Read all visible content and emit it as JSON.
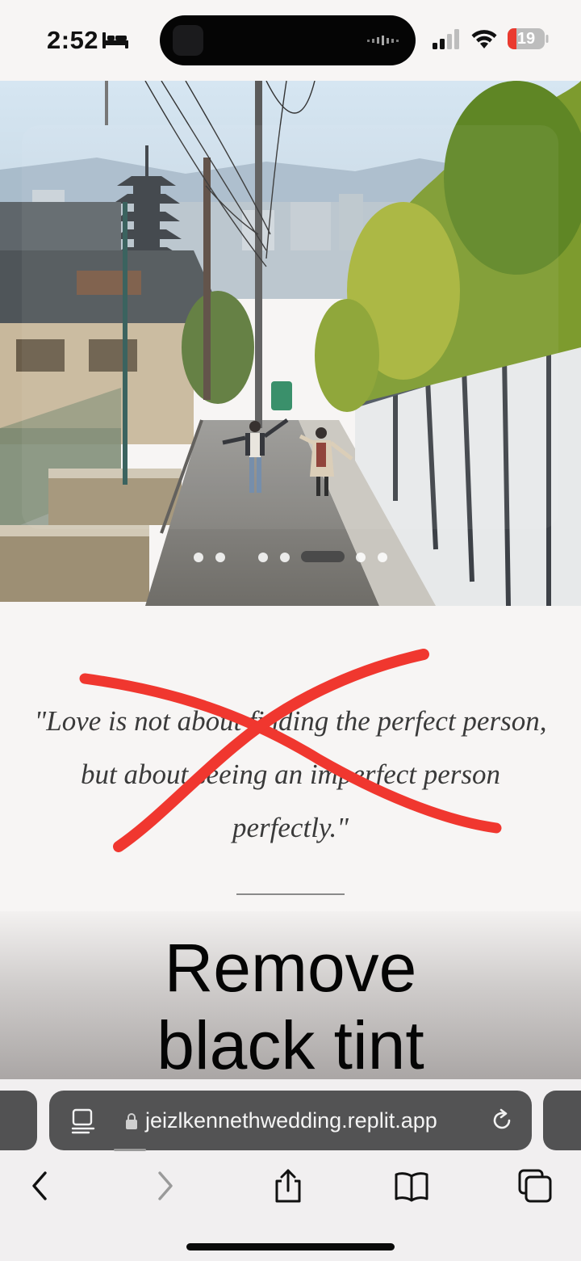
{
  "status_bar": {
    "time": "2:52",
    "battery": "19"
  },
  "carousel": {
    "slide_count": 7,
    "active_index": 5
  },
  "quote": {
    "lines": [
      "\"Love is not about finding the perfect person,",
      "but about seeing an imperfect person",
      "perfectly.\""
    ]
  },
  "overlay": {
    "lines": [
      "Remove",
      "black tint"
    ]
  },
  "browser": {
    "url": "jeizlkennethwedding.replit.app"
  },
  "colors": {
    "annotation_red": "#f0372f",
    "address_bar": "#535354",
    "battery_low": "#ea3a2f"
  },
  "icons": [
    "bed-icon",
    "cellular-signal-icon",
    "wifi-icon",
    "battery-icon",
    "reader-mode-icon",
    "lock-icon",
    "reload-icon",
    "back-icon",
    "forward-icon",
    "share-icon",
    "bookmarks-icon",
    "tabs-icon"
  ]
}
